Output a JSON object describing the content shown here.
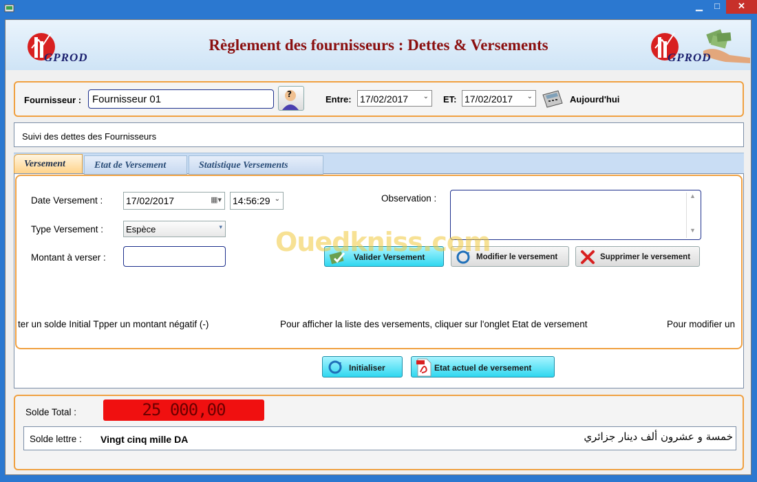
{
  "window": {
    "minimize": "▁",
    "maximize": "□",
    "close": "✕"
  },
  "header": {
    "title": "Règlement des fournisseurs : Dettes & Versements",
    "logo_text": "GPROD"
  },
  "filter": {
    "supplier_label": "Fournisseur :",
    "supplier_value": "Fournisseur 01",
    "from_label": "Entre:",
    "from_value": "17/02/2017",
    "to_label": "ET:",
    "to_value": "17/02/2017",
    "today_label": "Aujourd'hui"
  },
  "info_bar": "Suivi des dettes des Fournisseurs",
  "tabs": [
    {
      "label": "Versement"
    },
    {
      "label": "Etat de Versement"
    },
    {
      "label": "Statistique Versements"
    }
  ],
  "form": {
    "date_label": "Date Versement :",
    "date_value": "17/02/2017",
    "time_value": "14:56:29",
    "type_label": "Type Versement :",
    "type_value": "Espèce",
    "amount_label": "Montant  à verser :",
    "amount_value": "",
    "observation_label": "Observation :",
    "observation_value": ""
  },
  "actions": {
    "validate": "Valider Versement",
    "modify": "Modifier le versement",
    "delete": "Supprimer le versement"
  },
  "marquee": [
    "ter un solde Initial Tpper un montant négatif (-)",
    "Pour afficher la liste des versements, cliquer sur l'onglet Etat de versement",
    "Pour modifier un"
  ],
  "bottom_actions": {
    "reset": "Initialiser",
    "pdf": "Etat actuel de versement"
  },
  "totals": {
    "total_label": "Solde Total  :",
    "total_value": "25 000,00",
    "words_label": "Solde lettre  :",
    "words_fr": "Vingt cinq mille  DA",
    "words_ar": "خمسة و عشرون ألف دينار جزائري"
  },
  "watermark": "Ouedkniss.com",
  "colors": {
    "accent_orange": "#f0a040",
    "title_red": "#8b1010",
    "total_bg": "#f01010",
    "button_cyan": "#30d8f0"
  }
}
